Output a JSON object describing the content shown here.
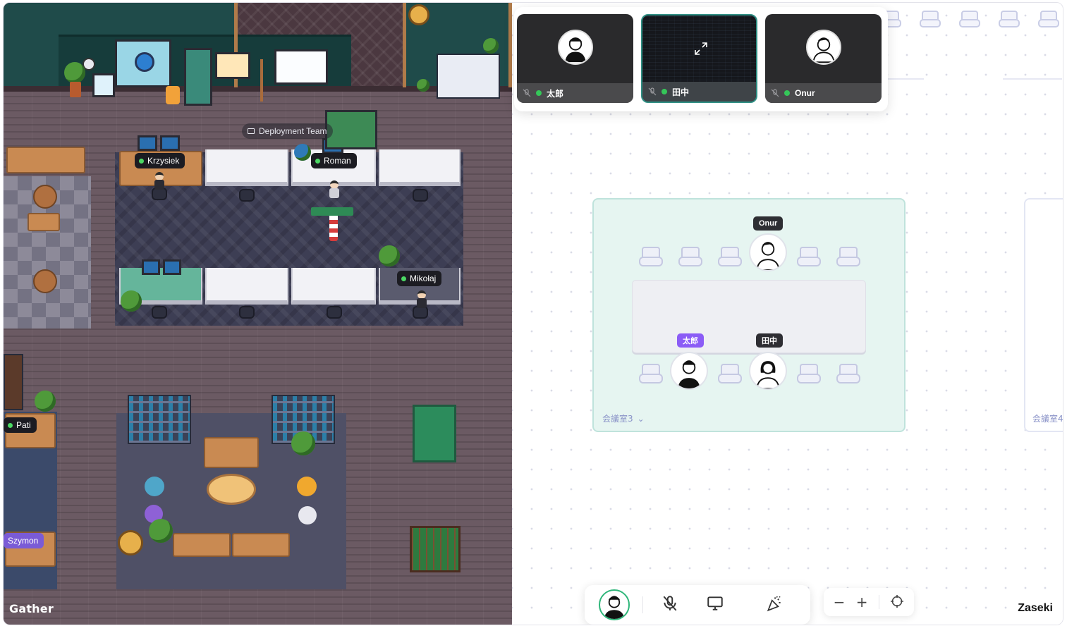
{
  "gather": {
    "brand": "Gather",
    "area_label": "Deployment Team",
    "players": [
      {
        "name": "Krzysiek",
        "online": true
      },
      {
        "name": "Roman",
        "online": true
      },
      {
        "name": "Mikołaj",
        "online": true
      },
      {
        "name": "Pati",
        "online": true
      },
      {
        "name": "Szymon",
        "online": false
      }
    ]
  },
  "zaseki": {
    "brand": "Zaseki",
    "video_tiles": [
      {
        "name": "太郎",
        "type": "camera",
        "muted": true
      },
      {
        "name": "田中",
        "type": "screen-share",
        "muted": true
      },
      {
        "name": "Onur",
        "type": "camera",
        "muted": true
      }
    ],
    "room": {
      "label": "会議室3",
      "seated": [
        {
          "name": "Onur",
          "side": "top",
          "tag_style": "dark"
        },
        {
          "name": "太郎",
          "side": "bottom",
          "tag_style": "violet"
        },
        {
          "name": "田中",
          "side": "bottom",
          "tag_style": "dark"
        }
      ]
    },
    "next_room_label": "会議室4",
    "toolbar": {
      "items": [
        "avatar",
        "mic-off-icon",
        "screen-share-icon",
        "reaction-icon"
      ]
    },
    "zoom": {
      "minus": "−",
      "plus": "+",
      "recenter": "recenter-icon"
    },
    "colors": {
      "accent_green": "#2fb67a",
      "room_bg": "#e6f5f1",
      "label_violet": "#8b5cf6"
    }
  }
}
